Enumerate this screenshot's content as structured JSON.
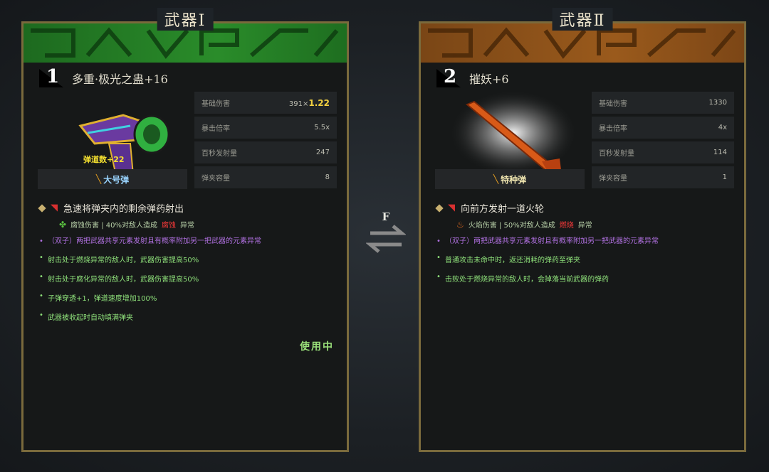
{
  "panels": [
    {
      "title": "武器Ⅰ",
      "slot": "1",
      "name": "多重·极光之蛊+16",
      "ammo_label": "弹道数+22",
      "ammo_type": "大号弹",
      "stats": [
        {
          "label": "基础伤害",
          "value": "391×",
          "highlight": "1.22"
        },
        {
          "label": "暴击倍率",
          "value": "5.5x",
          "highlight": ""
        },
        {
          "label": "百秒发射量",
          "value": "247",
          "highlight": ""
        },
        {
          "label": "弹夹容量",
          "value": "8",
          "highlight": ""
        }
      ],
      "effect_title": "急速将弹夹内的剩余弹药射出",
      "effect_sub_prefix": "腐蚀伤害 | 40%对敌人造成",
      "effect_sub_hl": "腐蚀",
      "effect_sub_suffix": "异常",
      "purple": "（双子）两把武器共享元素发射且有概率附加另一把武器的元素异常",
      "bullets": [
        "射击处于燃烧异常的敌人时，武器伤害提高50%",
        "射击处于腐化异常的敌人时，武器伤害提高50%",
        "子弹穿透+1，弹道速度增加100%",
        "武器被收起时自动填满弹夹"
      ],
      "status": "使用中"
    },
    {
      "title": "武器Ⅱ",
      "slot": "2",
      "name": "摧妖+6",
      "ammo_label": "",
      "ammo_type": "特种弹",
      "stats": [
        {
          "label": "基础伤害",
          "value": "1330",
          "highlight": ""
        },
        {
          "label": "暴击倍率",
          "value": "4x",
          "highlight": ""
        },
        {
          "label": "百秒发射量",
          "value": "114",
          "highlight": ""
        },
        {
          "label": "弹夹容量",
          "value": "1",
          "highlight": ""
        }
      ],
      "effect_title": "向前方发射一道火轮",
      "effect_sub_prefix": "火焰伤害 | 50%对敌人造成",
      "effect_sub_hl": "燃烧",
      "effect_sub_suffix": "异常",
      "purple": "（双子）两把武器共享元素发射且有概率附加另一把武器的元素异常",
      "bullets": [
        "普通攻击未命中时，返还消耗的弹药至弹夹",
        "击败处于燃烧异常的敌人时，会掉落当前武器的弹药"
      ],
      "status": ""
    }
  ],
  "switch_key": "F",
  "colors": {
    "banner1": "#2a8c2a",
    "banner2": "#9a5a1c",
    "frame": "#7a6a3c",
    "highlight": "#f2d040",
    "green_text": "#8ee07a",
    "purple_text": "#b070e0"
  }
}
